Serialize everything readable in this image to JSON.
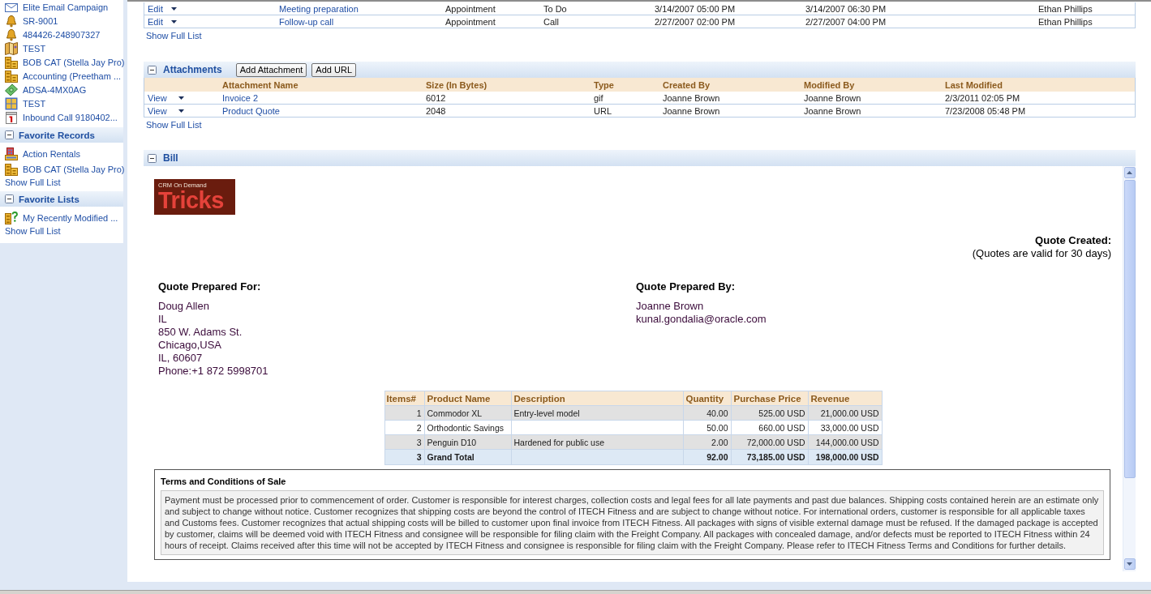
{
  "sidebar": {
    "recent_items": [
      {
        "label": "Elite Email Campaign",
        "kind": "campaign"
      },
      {
        "label": "SR-9001",
        "kind": "service_request"
      },
      {
        "label": "484426-248907327",
        "kind": "service_request"
      },
      {
        "label": "TEST",
        "kind": "solution"
      },
      {
        "label": "BOB CAT (Stella Jay Pro)",
        "kind": "account"
      },
      {
        "label": "Accounting (Preetham ...",
        "kind": "account"
      },
      {
        "label": "ADSA-4MX0AG",
        "kind": "opportunity"
      },
      {
        "label": "TEST",
        "kind": "portfolio"
      },
      {
        "label": "Inbound Call 9180402...",
        "kind": "activity"
      }
    ],
    "sections": [
      {
        "title": "Favorite Records",
        "expanded": true,
        "items": [
          {
            "label": "Action Rentals",
            "kind": "office"
          },
          {
            "label": "BOB CAT (Stella Jay Pro)",
            "kind": "account"
          }
        ],
        "show_full_list": "Show Full List"
      },
      {
        "title": "Favorite Lists",
        "expanded": true,
        "items": [
          {
            "label": "My Recently Modified ...",
            "kind": "list"
          }
        ],
        "show_full_list": "Show Full List"
      }
    ]
  },
  "activities": {
    "rows": [
      {
        "action": "Edit",
        "column_2": "Meeting preparation",
        "column_3": "Appointment",
        "column_4": "To Do",
        "column_5": "3/14/2007 05:00 PM",
        "column_6": "3/14/2007 06:30 PM",
        "column_7": "Ethan Phillips"
      },
      {
        "action": "Edit",
        "column_2": "Follow-up call",
        "column_3": "Appointment",
        "column_4": "Call",
        "column_5": "2/27/2007 02:00 PM",
        "column_6": "2/27/2007 04:00 PM",
        "column_7": "Ethan Phillips"
      }
    ],
    "show_full_list": "Show Full List"
  },
  "attachments": {
    "title": "Attachments",
    "expanded": true,
    "buttons": [
      "Add Attachment",
      "Add URL"
    ],
    "columns": [
      "Attachment Name",
      "Size (In Bytes)",
      "Type",
      "Created By",
      "Modified By",
      "Last Modified"
    ],
    "rows": [
      {
        "action": "View",
        "name": "Invoice 2",
        "size": "6012",
        "type": "gif",
        "created_by": "Joanne Brown",
        "modified_by": "Joanne Brown",
        "last_modified": "2/3/2011 02:05 PM"
      },
      {
        "action": "View",
        "name": "Product Quote",
        "size": "2048",
        "type": "URL",
        "created_by": "Joanne Brown",
        "modified_by": "Joanne Brown",
        "last_modified": "7/23/2008 05:48 PM"
      }
    ],
    "show_full_list": "Show Full List"
  },
  "bill": {
    "title": "Bill",
    "expanded": true,
    "logo": {
      "caption": "CRM On Demand",
      "wordmark": "Tricks"
    },
    "quote_created": "Quote Created:",
    "validity": "(Quotes are valid for 30 days)",
    "prepared_for": {
      "heading": "Quote Prepared For:",
      "lines": [
        "Doug Allen",
        "IL",
        "850 W. Adams St.",
        "Chicago,USA",
        "IL, 60607",
        "Phone:+1 872 5998701"
      ]
    },
    "prepared_by": {
      "heading": "Quote Prepared By:",
      "lines": [
        "Joanne Brown",
        "kunal.gondalia@oracle.com"
      ]
    },
    "products": {
      "columns": [
        "Items#",
        "Product Name",
        "Description",
        "Quantity",
        "Purchase Price",
        "Revenue"
      ],
      "rows": [
        {
          "number": "1",
          "product": "Commodor XL",
          "description": "Entry-level model",
          "quantity": "40.00",
          "price": "525.00 USD",
          "revenue": "21,000.00 USD"
        },
        {
          "number": "2",
          "product": "Orthodontic Savings",
          "quantity": "50.00",
          "price": "660.00 USD",
          "revenue": "33,000.00 USD"
        },
        {
          "number": "3",
          "product": "Penguin D10",
          "description": "Hardened for public use",
          "quantity": "2.00",
          "price": "72,000.00 USD",
          "revenue": "144,000.00 USD"
        }
      ],
      "total": {
        "number": "3",
        "product": "Grand Total",
        "quantity": "92.00",
        "price": "73,185.00 USD",
        "revenue": "198,000.00 USD"
      }
    },
    "terms": {
      "title": "Terms and Conditions of Sale",
      "text": "Payment must be processed prior to commencement of order. Customer is responsible for interest charges, collection costs and legal fees for all late payments and past due balances. Shipping costs contained herein are an estimate only and subject to change without notice. Customer recognizes that shipping costs are beyond the control of ITECH Fitness and are subject to change without notice. For international orders, customer is responsible for all applicable taxes and Customs fees. Customer recognizes that actual shipping costs will be billed to customer upon final invoice from ITECH Fitness. All packages with signs of visible external damage must be refused. If the damaged package is accepted by customer, claims will be deemed void with ITECH Fitness and consignee will be responsible for filing claim with the Freight Company. All packages with concealed damage, and/or defects must be reported to ITECH Fitness within 24 hours of receipt. Claims received after this time will not be accepted by ITECH Fitness and consignee is responsible for filing claim with the Freight Company. Please refer to ITECH Fitness Terms and Conditions for further details."
    }
  }
}
